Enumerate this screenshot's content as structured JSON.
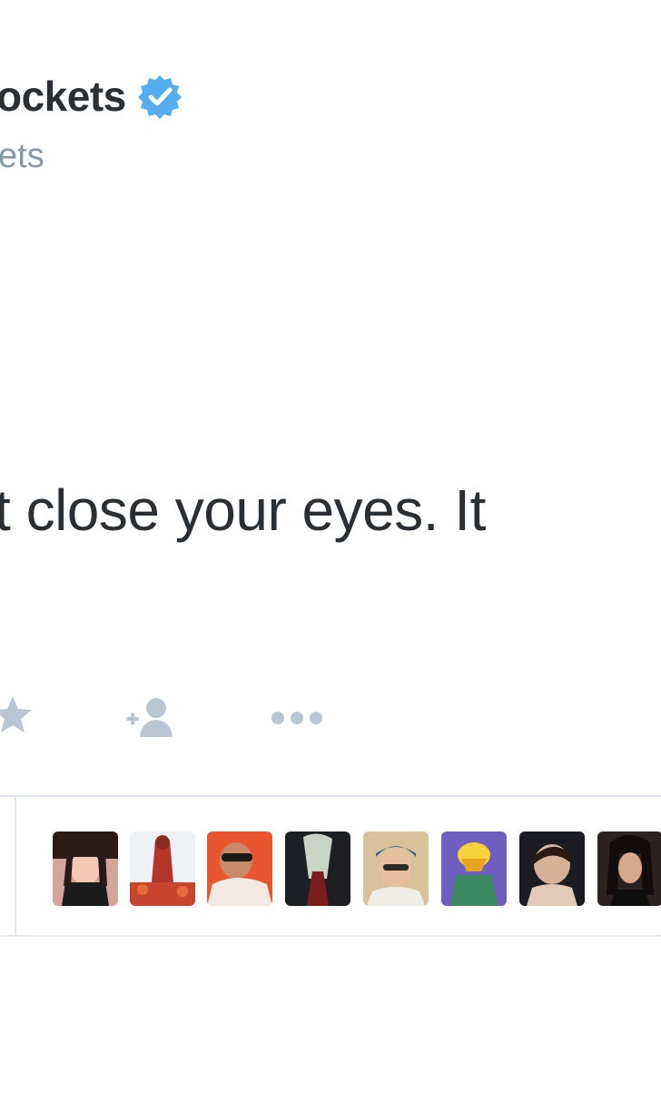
{
  "tweet": {
    "name": "ockets",
    "handle": "ets",
    "text": "t close your eyes. It "
  },
  "actions": {
    "favorite_icon": "star-icon",
    "follow_icon": "follow-icon",
    "more_icon": "more-icon"
  },
  "favorites": {
    "avatars": [
      "avatar-1",
      "avatar-2",
      "avatar-3",
      "avatar-4",
      "avatar-5",
      "avatar-6",
      "avatar-7",
      "avatar-8"
    ]
  },
  "colors": {
    "text": "#292f33",
    "muted": "#8899a6",
    "verified": "#55acee",
    "divider": "#e1e8ed"
  }
}
